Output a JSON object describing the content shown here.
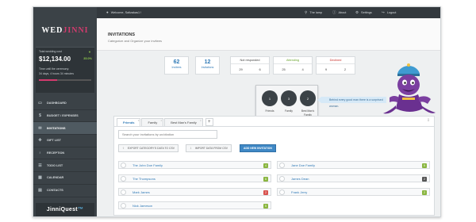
{
  "topbar": {
    "welcome": "Welcome, Saltzakas1 !",
    "the_lamp": "The lamp",
    "about": "About",
    "settings": "Settings",
    "logout": "Logout"
  },
  "sidebar": {
    "logo_main": "WED",
    "logo_tail": "JINNI",
    "total_cost_label": "Total wedding cost",
    "total_cost": "$12,134.00",
    "cost_change": "35.0%",
    "time_label": "Time until the ceremony:",
    "time_value": "34 days, 4 hours 34 minutes",
    "time_progress": 0.35,
    "nav": [
      {
        "label": "DASHBOARD",
        "icon": "monitor-icon"
      },
      {
        "label": "BUDGET / EXPENSES",
        "icon": "dollar-icon"
      },
      {
        "label": "INVITATIONS",
        "icon": "envelope-icon",
        "active": true
      },
      {
        "label": "GIFT LIST",
        "icon": "gift-icon"
      },
      {
        "label": "RECEPTION",
        "icon": "glass-icon"
      },
      {
        "label": "TODO LIST",
        "icon": "list-icon"
      },
      {
        "label": "CALENDAR",
        "icon": "calendar-icon"
      },
      {
        "label": "CONTACTS",
        "icon": "contacts-icon"
      }
    ],
    "brand_main": "JinniQuest",
    "brand_mark": "™"
  },
  "page": {
    "title": "INVITATIONS",
    "subtitle": "Categorize and Organize your invitees"
  },
  "stats": {
    "invitees_count": "62",
    "invitees_label": "Invitees",
    "invitations_count": "12",
    "invitations_label": "Invitations"
  },
  "rsvp": [
    {
      "title": "Not responded",
      "a": "29",
      "b": "6",
      "color": "#444444"
    },
    {
      "title": "Attending",
      "a": "25",
      "b": "4",
      "color": "#6aa52e"
    },
    {
      "title": "Declined",
      "a": "9",
      "b": "2",
      "color": "#c9302c"
    }
  ],
  "popover": [
    {
      "count": "1",
      "label": "Friends"
    },
    {
      "count": "3",
      "label": "Family"
    },
    {
      "count": "2",
      "label": "Best Man's Family"
    }
  ],
  "tip_text": "Behind every good man there is a surprised woman.",
  "tabs": [
    "Friends",
    "Family",
    "Best Man's Family"
  ],
  "search_placeholder": "Search your invitations by un/citation",
  "buttons": {
    "export": "EXPORT CATEGORY'S DATA TO CSV",
    "import": "IMPORT DATA FROM CSV",
    "add": "ADD NEW INVITATION"
  },
  "invitations": [
    {
      "name": "The John Doe Family",
      "count": "4",
      "status": "green"
    },
    {
      "name": "Jane Doe Family",
      "count": "5",
      "status": "green"
    },
    {
      "name": "The Thompsons",
      "count": "6",
      "status": "green"
    },
    {
      "name": "James Dean",
      "count": "2",
      "status": "dark"
    },
    {
      "name": "Mark James",
      "count": "2",
      "status": "red"
    },
    {
      "name": "Frank Jerry",
      "count": "2",
      "status": "green"
    },
    {
      "name": "Nick Jameson",
      "count": "5",
      "status": "green"
    }
  ]
}
